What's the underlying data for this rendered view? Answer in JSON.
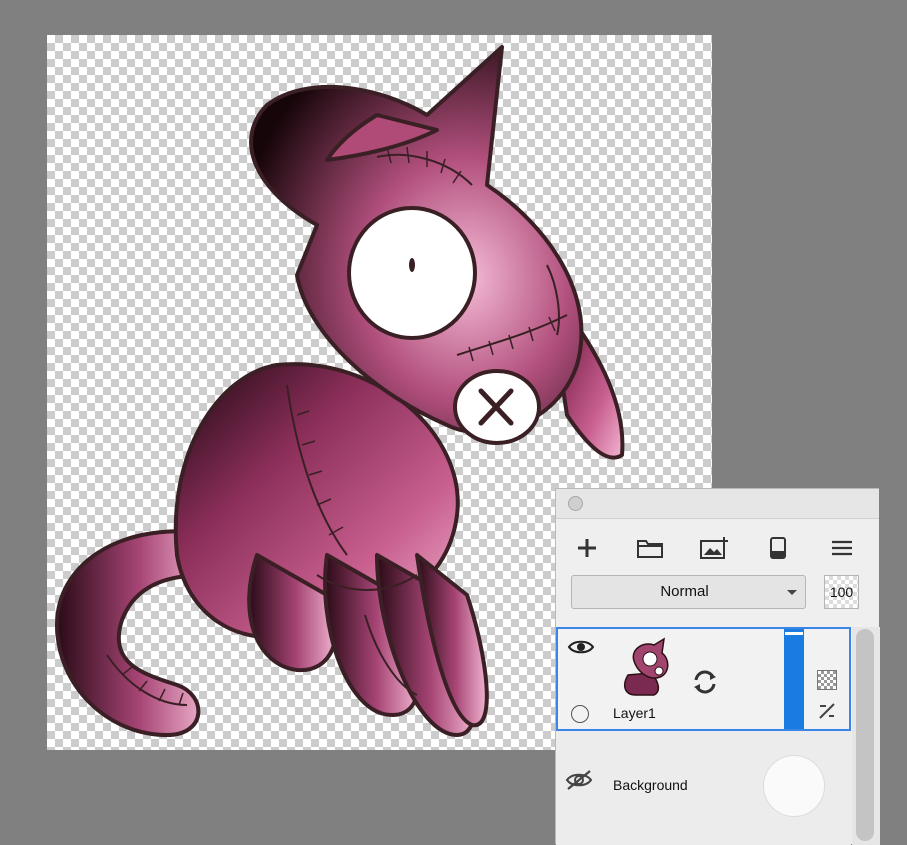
{
  "canvas": {
    "artwork": "pink stitched ragdoll cat illustration on a transparent layer",
    "colors": {
      "body": "#a2456e",
      "outline": "#3a2025",
      "highlight": "#f4b9d3",
      "shadow": "#140609"
    }
  },
  "layers_panel": {
    "toolbar": [
      {
        "icon": "plus-icon",
        "action": "New layer"
      },
      {
        "icon": "folder-icon",
        "action": "New group"
      },
      {
        "icon": "image-add-icon",
        "action": "Add image"
      },
      {
        "icon": "eraser-icon",
        "action": "Clear layer"
      },
      {
        "icon": "menu-icon",
        "action": "More options"
      }
    ],
    "blend_mode": "Normal",
    "opacity": "100",
    "layers": [
      {
        "name": "Layer1",
        "visible": true,
        "selected": true
      },
      {
        "name": "Background",
        "visible": false,
        "selected": false
      }
    ],
    "accent_color": "#1a7be0"
  }
}
